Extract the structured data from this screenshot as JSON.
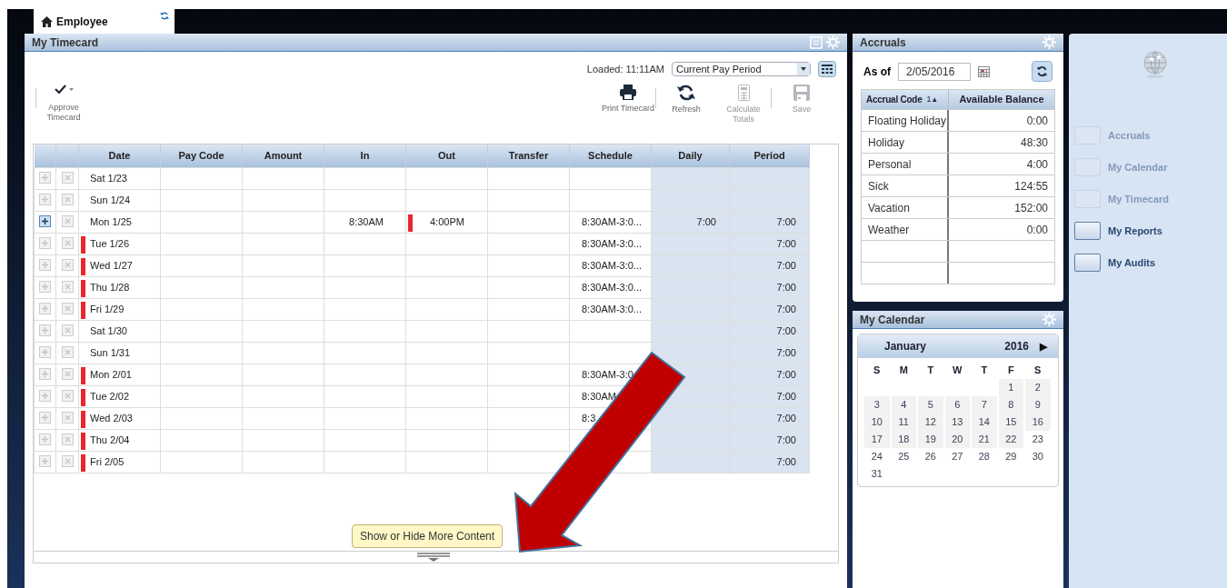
{
  "top_tab": {
    "label": "Employee"
  },
  "timecard": {
    "title": "My Timecard",
    "loaded": "Loaded: 11:11AM",
    "period": "Current Pay Period",
    "approve": {
      "label": "Approve Timecard"
    },
    "actions": [
      {
        "kind": "print",
        "label": "Print Timecard",
        "disabled": false
      },
      {
        "kind": "refresh",
        "label": "Refresh",
        "disabled": false
      },
      {
        "kind": "calculate",
        "label": "Calculate Totals",
        "disabled": true
      },
      {
        "kind": "save",
        "label": "Save",
        "disabled": true
      }
    ],
    "columns": [
      "Date",
      "Pay Code",
      "Amount",
      "In",
      "Out",
      "Transfer",
      "Schedule",
      "Daily",
      "Period"
    ],
    "rows": [
      {
        "date": "Sat 1/23",
        "exception": false,
        "add_enabled": false
      },
      {
        "date": "Sun 1/24",
        "exception": false,
        "add_enabled": false
      },
      {
        "date": "Mon 1/25",
        "exception": false,
        "add_enabled": true,
        "in": "8:30AM",
        "out": "4:00PM",
        "out_exception": true,
        "schedule": "8:30AM-3:0...",
        "daily": "7:00",
        "period": "7:00"
      },
      {
        "date": "Tue 1/26",
        "exception": true,
        "add_enabled": false,
        "schedule": "8:30AM-3:0...",
        "period": "7:00"
      },
      {
        "date": "Wed 1/27",
        "exception": true,
        "add_enabled": false,
        "schedule": "8:30AM-3:0...",
        "period": "7:00"
      },
      {
        "date": "Thu 1/28",
        "exception": true,
        "add_enabled": false,
        "schedule": "8:30AM-3:0...",
        "period": "7:00"
      },
      {
        "date": "Fri 1/29",
        "exception": true,
        "add_enabled": false,
        "schedule": "8:30AM-3:0...",
        "period": "7:00"
      },
      {
        "date": "Sat 1/30",
        "exception": false,
        "add_enabled": false,
        "period": "7:00"
      },
      {
        "date": "Sun 1/31",
        "exception": false,
        "add_enabled": false,
        "period": "7:00"
      },
      {
        "date": "Mon 2/01",
        "exception": true,
        "add_enabled": false,
        "schedule": "8:30AM-3:0",
        "period": "7:00"
      },
      {
        "date": "Tue 2/02",
        "exception": true,
        "add_enabled": false,
        "schedule": "8:30AM",
        "period": "7:00"
      },
      {
        "date": "Wed 2/03",
        "exception": true,
        "add_enabled": false,
        "schedule": "8:3",
        "period": "7:00"
      },
      {
        "date": "Thu 2/04",
        "exception": true,
        "add_enabled": false,
        "period": "7:00"
      },
      {
        "date": "Fri 2/05",
        "exception": true,
        "add_enabled": false,
        "period": "7:00"
      }
    ],
    "tooltip": "Show or Hide More Content"
  },
  "accruals": {
    "title": "Accruals",
    "as_of_label": "As of",
    "as_of": "2/05/2016",
    "columns": [
      "Accrual Code",
      "1 ▴",
      "Available Balance"
    ],
    "rows": [
      {
        "code": "Floating Holiday",
        "balance": "0:00"
      },
      {
        "code": "Holiday",
        "balance": "48:30"
      },
      {
        "code": "Personal",
        "balance": "4:00"
      },
      {
        "code": "Sick",
        "balance": "124:55"
      },
      {
        "code": "Vacation",
        "balance": "152:00"
      },
      {
        "code": "Weather",
        "balance": "0:00"
      }
    ]
  },
  "calendar": {
    "title": "My Calendar",
    "month": "January",
    "year": "2016",
    "next": "▶",
    "weekdays": [
      "S",
      "M",
      "T",
      "W",
      "T",
      "F",
      "S"
    ],
    "weeks": [
      [
        {
          "day": "1",
          "shaded": true
        },
        {
          "day": "2",
          "shaded": true
        }
      ],
      [
        {
          "day": "3",
          "shaded": true
        },
        {
          "day": "4",
          "shaded": true
        },
        {
          "day": "5",
          "shaded": true
        },
        {
          "day": "6",
          "shaded": true
        },
        {
          "day": "7",
          "shaded": true
        },
        {
          "day": "8",
          "shaded": true
        },
        {
          "day": "9",
          "shaded": true
        }
      ],
      [
        {
          "day": "10",
          "shaded": true
        },
        {
          "day": "11",
          "shaded": true
        },
        {
          "day": "12",
          "shaded": true
        },
        {
          "day": "13",
          "shaded": true
        },
        {
          "day": "14",
          "shaded": true
        },
        {
          "day": "15",
          "shaded": true
        },
        {
          "day": "16",
          "shaded": true
        }
      ],
      [
        {
          "day": "17",
          "shaded": true
        },
        {
          "day": "18",
          "shaded": true
        },
        {
          "day": "19",
          "shaded": true
        },
        {
          "day": "20",
          "shaded": true
        },
        {
          "day": "21",
          "shaded": true
        },
        {
          "day": "22",
          "shaded": true
        },
        {
          "day": "23",
          "shaded": false
        }
      ],
      [
        {
          "day": "24",
          "shaded": false
        },
        {
          "day": "25",
          "shaded": false
        },
        {
          "day": "26",
          "shaded": false
        },
        {
          "day": "27",
          "shaded": false
        },
        {
          "day": "28",
          "shaded": false
        },
        {
          "day": "29",
          "shaded": false
        },
        {
          "day": "30",
          "shaded": false
        }
      ],
      [
        {
          "day": "31",
          "shaded": false
        }
      ]
    ]
  },
  "widgets": [
    {
      "label": "Accruals",
      "disabled": true
    },
    {
      "label": "My Calendar",
      "disabled": true
    },
    {
      "label": "My Timecard",
      "disabled": true
    },
    {
      "label": "My Reports",
      "disabled": false
    },
    {
      "label": "My Audits",
      "disabled": false
    }
  ]
}
